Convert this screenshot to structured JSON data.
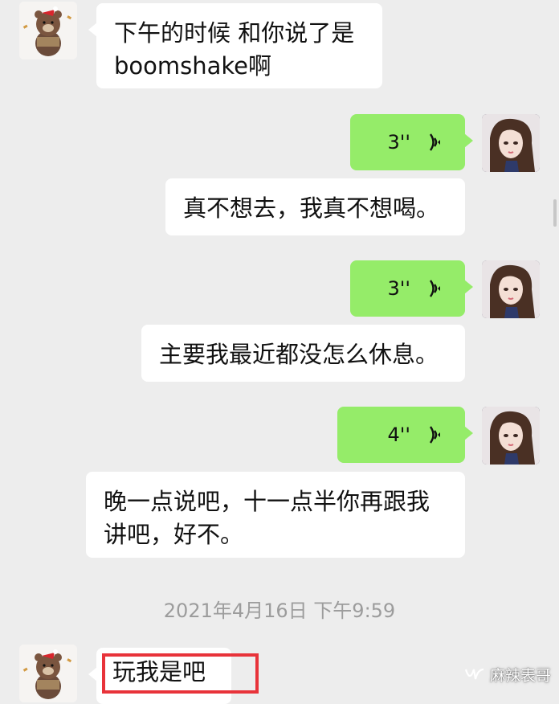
{
  "messages": [
    {
      "sender": "friend",
      "type": "text",
      "text": "下午的时候 和你说了是 boomshake啊"
    },
    {
      "sender": "me",
      "type": "voice",
      "duration": "3''"
    },
    {
      "sender": "me",
      "type": "text",
      "text": "真不想去，我真不想喝。"
    },
    {
      "sender": "me",
      "type": "voice",
      "duration": "3''"
    },
    {
      "sender": "me",
      "type": "text",
      "text": "主要我最近都没怎么休息。"
    },
    {
      "sender": "me",
      "type": "voice",
      "duration": "4''"
    },
    {
      "sender": "me",
      "type": "text",
      "text": "晚一点说吧，十一点半你再跟我讲吧，好不。"
    },
    {
      "sender": "friend",
      "type": "text",
      "text": "玩我是吧"
    }
  ],
  "timestamp": "2021年4月16日 下午9:59",
  "watermark": "麻辣表哥",
  "colors": {
    "background": "#ededed",
    "bubble_me": "#95ec69",
    "bubble_other": "#ffffff",
    "highlight_box": "#e8333a"
  },
  "icons": {
    "voice": "voice-wave-icon",
    "friend_avatar": "bear-avatar",
    "my_avatar": "girl-avatar",
    "watermark": "wechat-channel-icon"
  }
}
